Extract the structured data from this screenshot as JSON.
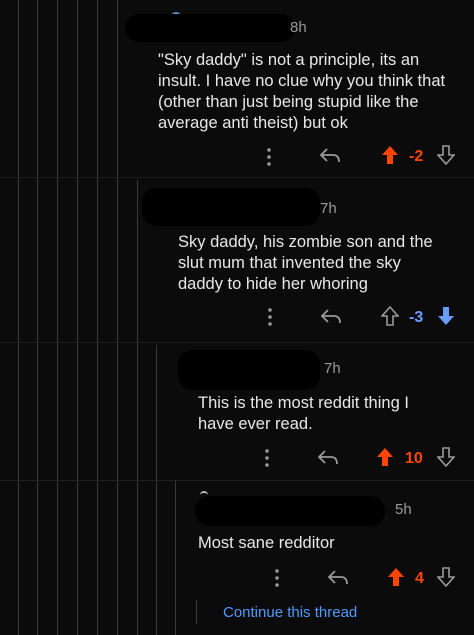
{
  "colors": {
    "background": "#0b0b0b",
    "text": "#e8e8e8",
    "muted": "#9a9a9a",
    "upvote": "#ff4500",
    "downvote": "#6a9bff",
    "link": "#4f9bff"
  },
  "comments": [
    {
      "time": "8h",
      "body": "\"Sky daddy\" is not a principle, its an insult. I have no clue why you think that (other than just being stupid like the average anti theist) but ok",
      "score": "-2",
      "vote_state": "upvoted",
      "icons": [
        "more-icon",
        "reply-icon",
        "upvote-icon",
        "downvote-icon"
      ]
    },
    {
      "time": "7h",
      "body": "Sky daddy, his zombie son and the slut mum that invented the sky daddy to hide her whoring",
      "score": "-3",
      "vote_state": "downvoted",
      "icons": [
        "more-icon",
        "reply-icon",
        "upvote-icon",
        "downvote-icon"
      ]
    },
    {
      "time": "7h",
      "body": "This is the most reddit thing I have ever read.",
      "score": "10",
      "vote_state": "upvoted",
      "icons": [
        "more-icon",
        "reply-icon",
        "upvote-icon",
        "downvote-icon"
      ]
    },
    {
      "time": "5h",
      "body": "Most sane redditor",
      "score": "4",
      "vote_state": "upvoted",
      "icons": [
        "more-icon",
        "reply-icon",
        "upvote-icon",
        "downvote-icon"
      ]
    }
  ],
  "continue_thread": "Continue this thread"
}
